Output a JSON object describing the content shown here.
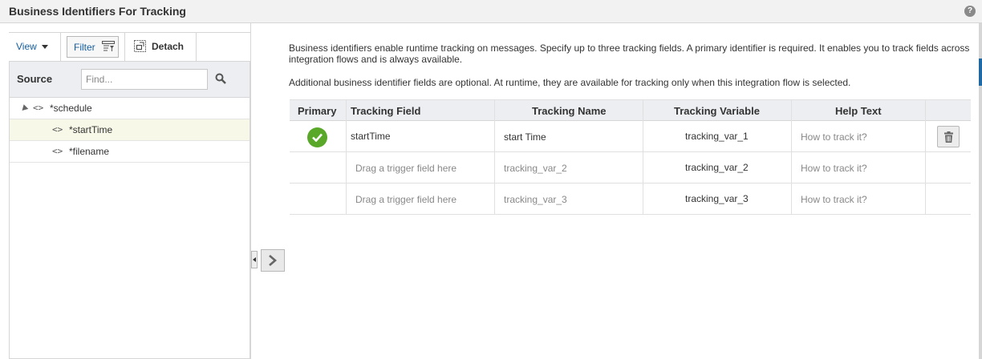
{
  "header": {
    "title": "Business Identifiers For Tracking",
    "help_icon": "question-mark"
  },
  "toolbar": {
    "view_label": "View",
    "filter_label": "Filter",
    "detach_label": "Detach"
  },
  "source": {
    "label": "Source",
    "find_placeholder": "Find...",
    "tree": [
      {
        "label": "*schedule",
        "level": 0,
        "expanded": true,
        "selected": false
      },
      {
        "label": "*startTime",
        "level": 1,
        "selected": true
      },
      {
        "label": "*filename",
        "level": 1,
        "selected": false
      }
    ]
  },
  "description": {
    "line1": "Business identifiers enable runtime tracking on messages. Specify up to three tracking fields. A primary identifier is required. It enables you to track fields across integration flows and is always available.",
    "line2": "Additional business identifier fields are optional. At runtime, they are available for tracking only when this integration flow is selected."
  },
  "table": {
    "columns": [
      "Primary",
      "Tracking Field",
      "Tracking Name",
      "Tracking Variable",
      "Help Text"
    ],
    "rows": [
      {
        "primary": true,
        "field": "startTime",
        "name": "start Time",
        "variable": "tracking_var_1",
        "help": "How to track it?",
        "deletable": true
      },
      {
        "primary": false,
        "field": "Drag a trigger field here",
        "name": "tracking_var_2",
        "variable": "tracking_var_2",
        "help": "How to track it?",
        "deletable": false
      },
      {
        "primary": false,
        "field": "Drag a trigger field here",
        "name": "tracking_var_3",
        "variable": "tracking_var_3",
        "help": "How to track it?",
        "deletable": false
      }
    ]
  },
  "colors": {
    "link": "#145c9e",
    "check": "#5aa82a",
    "header_bg": "#eceef1"
  }
}
